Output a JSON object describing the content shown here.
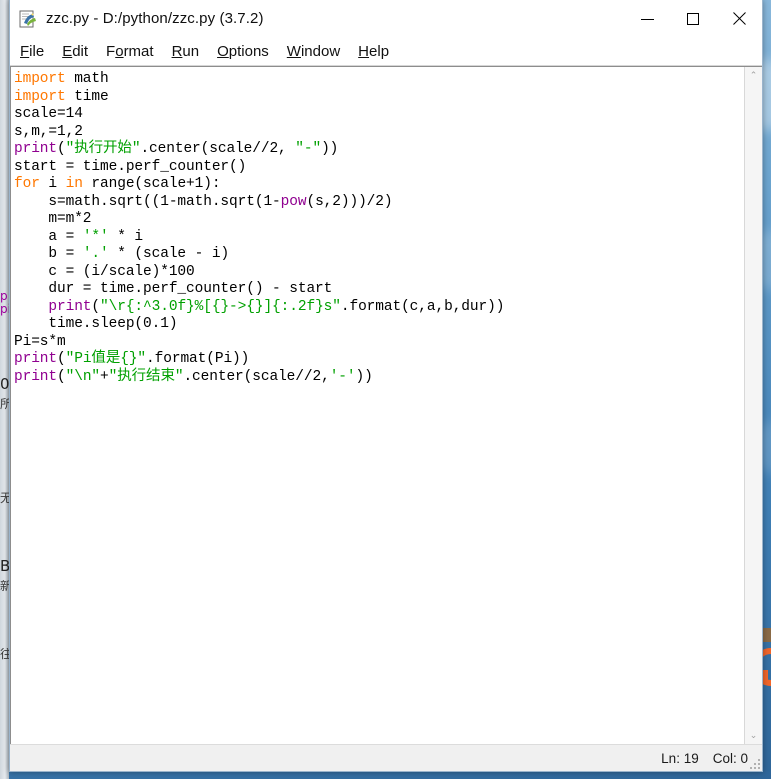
{
  "window": {
    "title": "zzc.py - D:/python/zzc.py (3.7.2)",
    "icon_name": "idle-python-icon",
    "controls": {
      "minimize_label": "Minimize",
      "maximize_label": "Maximize",
      "close_label": "Close"
    }
  },
  "menu": {
    "items": [
      {
        "label": "File",
        "mnemonic": "F"
      },
      {
        "label": "Edit",
        "mnemonic": "E"
      },
      {
        "label": "Format",
        "mnemonic": "o"
      },
      {
        "label": "Run",
        "mnemonic": "R"
      },
      {
        "label": "Options",
        "mnemonic": "O"
      },
      {
        "label": "Window",
        "mnemonic": "W"
      },
      {
        "label": "Help",
        "mnemonic": "H"
      }
    ]
  },
  "editor": {
    "language": "python",
    "filename": "zzc.py",
    "lines": [
      [
        {
          "t": "import",
          "c": "kw"
        },
        {
          "t": " math",
          "c": ""
        }
      ],
      [
        {
          "t": "import",
          "c": "kw"
        },
        {
          "t": " time",
          "c": ""
        }
      ],
      [
        {
          "t": "scale=14",
          "c": ""
        }
      ],
      [
        {
          "t": "s,m,=1,2",
          "c": ""
        }
      ],
      [
        {
          "t": "print",
          "c": "bi"
        },
        {
          "t": "(",
          "c": ""
        },
        {
          "t": "\"执行开始\"",
          "c": "str"
        },
        {
          "t": ".center(scale//2, ",
          "c": ""
        },
        {
          "t": "\"-\"",
          "c": "str"
        },
        {
          "t": "))",
          "c": ""
        }
      ],
      [
        {
          "t": "start = time.perf_counter()",
          "c": ""
        }
      ],
      [
        {
          "t": "for",
          "c": "kw"
        },
        {
          "t": " i ",
          "c": ""
        },
        {
          "t": "in",
          "c": "kw"
        },
        {
          "t": " range(scale+1):",
          "c": ""
        }
      ],
      [
        {
          "t": "    s=math.sqrt((1-math.sqrt(1-",
          "c": ""
        },
        {
          "t": "pow",
          "c": "bi"
        },
        {
          "t": "(s,2)))/2)",
          "c": ""
        }
      ],
      [
        {
          "t": "    m=m*2",
          "c": ""
        }
      ],
      [
        {
          "t": "    a = ",
          "c": ""
        },
        {
          "t": "'*'",
          "c": "str"
        },
        {
          "t": " * i",
          "c": ""
        }
      ],
      [
        {
          "t": "    b = ",
          "c": ""
        },
        {
          "t": "'.'",
          "c": "str"
        },
        {
          "t": " * (scale - i)",
          "c": ""
        }
      ],
      [
        {
          "t": "    c = (i/scale)*100",
          "c": ""
        }
      ],
      [
        {
          "t": "    dur = time.perf_counter() - start",
          "c": ""
        }
      ],
      [
        {
          "t": "    ",
          "c": ""
        },
        {
          "t": "print",
          "c": "bi"
        },
        {
          "t": "(",
          "c": ""
        },
        {
          "t": "\"\\r{:^3.0f}%[{}->{}]{:.2f}s\"",
          "c": "str"
        },
        {
          "t": ".format(c,a,b,dur))",
          "c": ""
        }
      ],
      [
        {
          "t": "    time.sleep(0.1)",
          "c": ""
        }
      ],
      [
        {
          "t": "Pi=s*m",
          "c": ""
        }
      ],
      [
        {
          "t": "print",
          "c": "bi"
        },
        {
          "t": "(",
          "c": ""
        },
        {
          "t": "\"Pi值是{}\"",
          "c": "str"
        },
        {
          "t": ".format(Pi))",
          "c": ""
        }
      ],
      [
        {
          "t": "print",
          "c": "bi"
        },
        {
          "t": "(",
          "c": ""
        },
        {
          "t": "\"\\n\"",
          "c": "str"
        },
        {
          "t": "+",
          "c": ""
        },
        {
          "t": "\"执行结束\"",
          "c": "str"
        },
        {
          "t": ".center(scale//2,",
          "c": ""
        },
        {
          "t": "'-'",
          "c": "str"
        },
        {
          "t": "))",
          "c": ""
        }
      ],
      []
    ],
    "scrollbar": {
      "up_arrow": "⌃",
      "down_arrow": "⌄"
    }
  },
  "status": {
    "line_label": "Ln: 19",
    "col_label": "Col: 0"
  },
  "colors": {
    "keyword": "#ff7700",
    "builtin": "#900090",
    "string": "#00a000",
    "definition": "#0000ff",
    "editor_background": "#ffffff",
    "window_chrome": "#f0f0f0",
    "desktop": "#3f7fb5",
    "desktop_icon_accent": "#f2662a"
  },
  "background": {
    "left_window_glyphs": [
      "p",
      "pi",
      "0",
      "所",
      "无",
      "B",
      "新",
      "往"
    ],
    "desktop_icon_name": "orange-shortcut-icon"
  }
}
